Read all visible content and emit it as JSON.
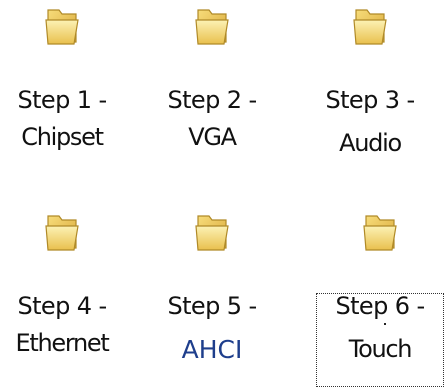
{
  "folders": [
    {
      "line1": "Step 1 -",
      "line2": "Chipset",
      "icon": "folder-icon"
    },
    {
      "line1": "Step 2 -",
      "line2": "VGA",
      "icon": "folder-icon"
    },
    {
      "line1": "Step 3 -",
      "line2": "Audio",
      "icon": "folder-icon"
    },
    {
      "line1": "Step 4 -",
      "line2": "Ethernet",
      "icon": "folder-icon"
    },
    {
      "line1": "Step 5 -",
      "line2": "AHCI",
      "icon": "folder-icon"
    },
    {
      "line1": "Step 6 -",
      "line2": "Touch",
      "icon": "folder-icon"
    }
  ],
  "colors": {
    "folder_fill": "#F5D56A",
    "folder_light": "#FBEFA8",
    "folder_outline": "#B08A28",
    "ahci_text": "#1E3E8C"
  }
}
